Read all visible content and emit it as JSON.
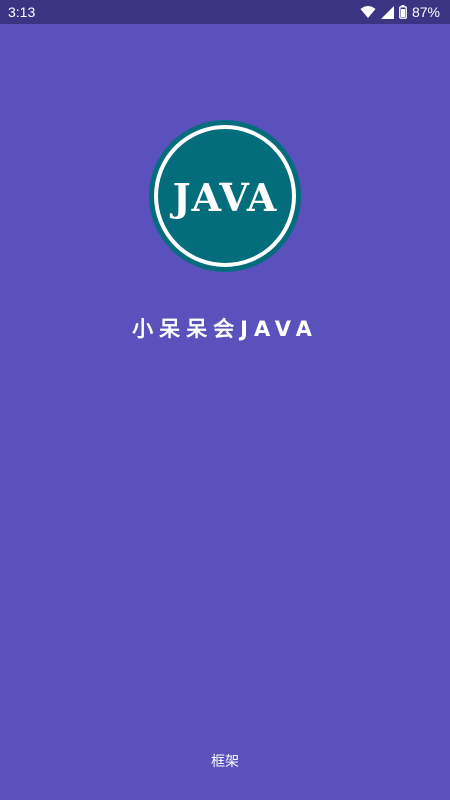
{
  "status_bar": {
    "time": "3:13",
    "battery_percent": "87%",
    "icons": [
      "wifi-icon",
      "cellular-signal-icon",
      "battery-icon"
    ]
  },
  "splash": {
    "logo_text": "JAVA",
    "app_name": "小呆呆会JAVA",
    "footer": "框架"
  },
  "colors": {
    "background": "#5a51bd",
    "status_bar": "#3b3482",
    "logo_fill": "#046d7c",
    "text": "#ffffff"
  }
}
